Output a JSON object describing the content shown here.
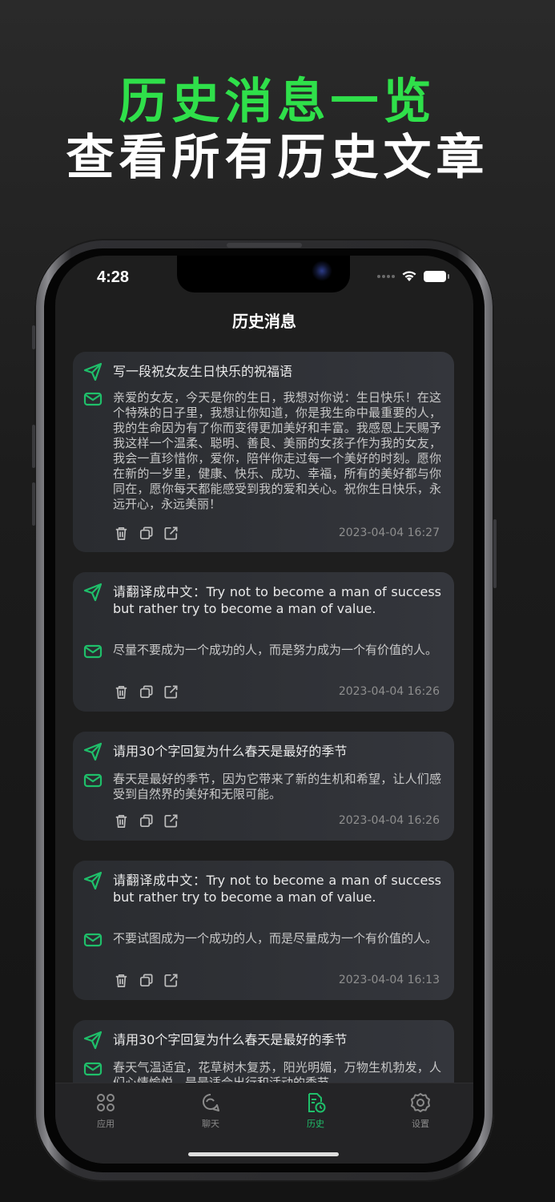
{
  "promo": {
    "headline_green": "历史消息一览",
    "headline_white": "查看所有历史文章"
  },
  "status_bar": {
    "time": "4:28"
  },
  "nav": {
    "title": "历史消息"
  },
  "accent_color": "#1fbf6a",
  "icons": {
    "question": "send-icon",
    "answer": "mail-icon",
    "delete": "trash-icon",
    "copy": "copy-icon",
    "share": "share-icon"
  },
  "messages": [
    {
      "question": "写一段祝女友生日快乐的祝福语",
      "answer": "亲爱的女友，今天是你的生日，我想对你说：生日快乐！在这个特殊的日子里，我想让你知道，你是我生命中最重要的人，我的生命因为有了你而变得更加美好和丰富。我感恩上天赐予我这样一个温柔、聪明、善良、美丽的女孩子作为我的女友，我会一直珍惜你，爱你，陪伴你走过每一个美好的时刻。愿你在新的一岁里，健康、快乐、成功、幸福，所有的美好都与你同在，愿你每天都能感受到我的爱和关心。祝你生日快乐，永远开心，永远美丽！",
      "time": "2023-04-04 16:27"
    },
    {
      "question": "请翻译成中文：Try not to become a man of success but rather try to become a man of value.",
      "answer": "尽量不要成为一个成功的人，而是努力成为一个有价值的人。",
      "time": "2023-04-04 16:26"
    },
    {
      "question": "请用30个字回复为什么春天是最好的季节",
      "answer": "春天是最好的季节，因为它带来了新的生机和希望，让人们感受到自然界的美好和无限可能。",
      "time": "2023-04-04 16:26"
    },
    {
      "question": "请翻译成中文：Try not to become a man of success but rather try to become a man of value.",
      "answer": "不要试图成为一个成功的人，而是尽量成为一个有价值的人。",
      "time": "2023-04-04 16:13"
    },
    {
      "question": "请用30个字回复为什么春天是最好的季节",
      "answer": "春天气温适宜，花草树木复苏，阳光明媚，万物生机勃发，人们心情愉悦，是最适合出行和活动的季节。",
      "time": ""
    }
  ],
  "tabs": [
    {
      "label": "应用",
      "icon": "apps-grid-icon",
      "active": false
    },
    {
      "label": "聊天",
      "icon": "chat-bubble-icon",
      "active": false
    },
    {
      "label": "历史",
      "icon": "history-doc-icon",
      "active": true
    },
    {
      "label": "设置",
      "icon": "gear-icon",
      "active": false
    }
  ]
}
